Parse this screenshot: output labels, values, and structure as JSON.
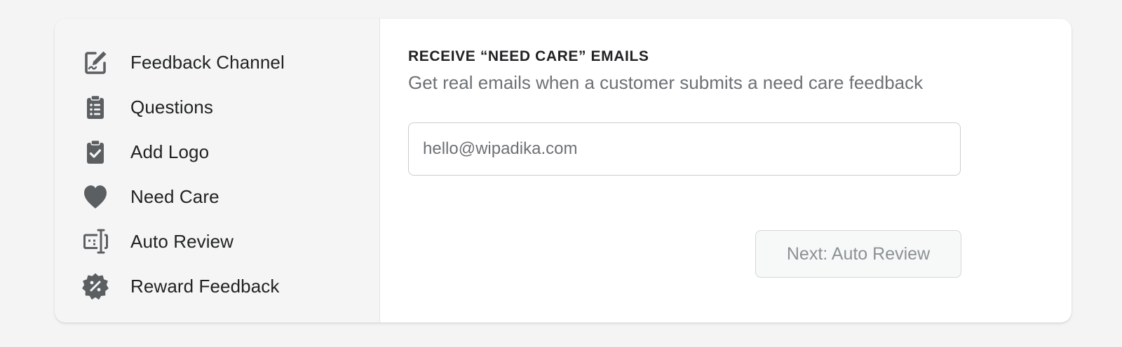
{
  "sidebar": {
    "items": [
      {
        "label": "Feedback Channel",
        "icon": "edit-icon"
      },
      {
        "label": "Questions",
        "icon": "clipboard-list-icon"
      },
      {
        "label": "Add Logo",
        "icon": "clipboard-check-icon"
      },
      {
        "label": "Need Care",
        "icon": "heart-icon"
      },
      {
        "label": "Auto Review",
        "icon": "text-cursor-icon"
      },
      {
        "label": "Reward Feedback",
        "icon": "discount-badge-icon"
      }
    ]
  },
  "main": {
    "heading": "Receive “Need Care” emails",
    "subheading": "Get real emails when a customer submits a need care feedback",
    "email_input": {
      "value": "",
      "placeholder": "hello@wipadika.com"
    },
    "next_button_label": "Next: Auto Review"
  },
  "colors": {
    "icon": "#5c5f62",
    "text": "#202223",
    "subdued_text": "#6d7175",
    "sidebar_bg": "#f5f5f5",
    "card_bg": "#ffffff",
    "disabled_button_text": "#8c9196"
  }
}
